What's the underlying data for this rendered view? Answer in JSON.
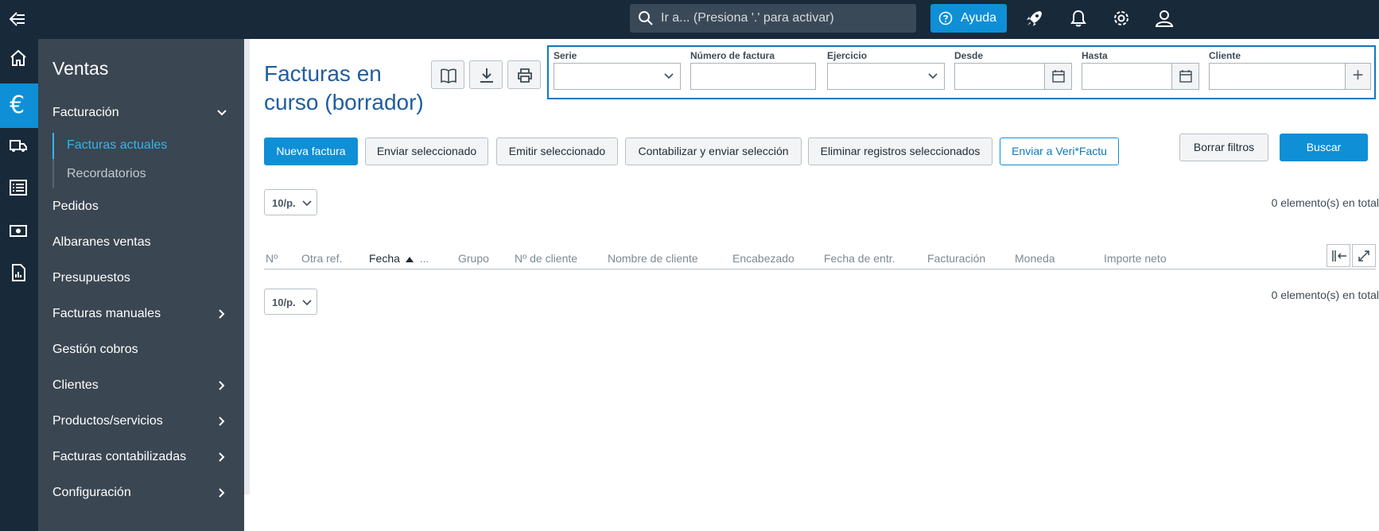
{
  "topbar": {
    "search_placeholder": "Ir a... (Presiona '.' para activar)",
    "help_label": "Ayuda"
  },
  "sidebar": {
    "title": "Ventas",
    "items": [
      {
        "label": "Facturación",
        "expanded": true
      },
      {
        "label": "Pedidos"
      },
      {
        "label": "Albaranes ventas"
      },
      {
        "label": "Presupuestos"
      },
      {
        "label": "Facturas manuales"
      },
      {
        "label": "Gestión cobros"
      },
      {
        "label": "Clientes"
      },
      {
        "label": "Productos/servicios"
      },
      {
        "label": "Facturas contabilizadas"
      },
      {
        "label": "Configuración"
      }
    ],
    "subitems": [
      {
        "label": "Facturas actuales",
        "active": true
      },
      {
        "label": "Recordatorios"
      }
    ]
  },
  "main": {
    "title": "Facturas en curso (borrador)",
    "filters": {
      "serie": "Serie",
      "numero": "Número de factura",
      "ejercicio": "Ejercicio",
      "desde": "Desde",
      "hasta": "Hasta",
      "cliente": "Cliente"
    },
    "actions": {
      "new": "Nueva factura",
      "send": "Enviar seleccionado",
      "issue": "Emitir seleccionado",
      "account": "Contabilizar y enviar selección",
      "delete": "Eliminar registros seleccionados",
      "verifactu": "Enviar a Veri*Factu",
      "clear": "Borrar filtros",
      "search": "Buscar"
    },
    "pager_label": "10/p.",
    "total_text": "0 elemento(s) en total",
    "columns": [
      "Nº",
      "Otra ref.",
      "Fecha",
      "Grupo",
      "Nº de cliente",
      "Nombre de cliente",
      "Encabezado",
      "Fecha de entr.",
      "Facturación",
      "Moneda",
      "Importe neto"
    ],
    "sorted_column_extra": "..."
  },
  "colors": {
    "topbar": "#18293a",
    "accent": "#0f8fd6",
    "sidenav": "#3a4651",
    "title": "#1f5ea0",
    "active_link": "#32b7f0"
  }
}
